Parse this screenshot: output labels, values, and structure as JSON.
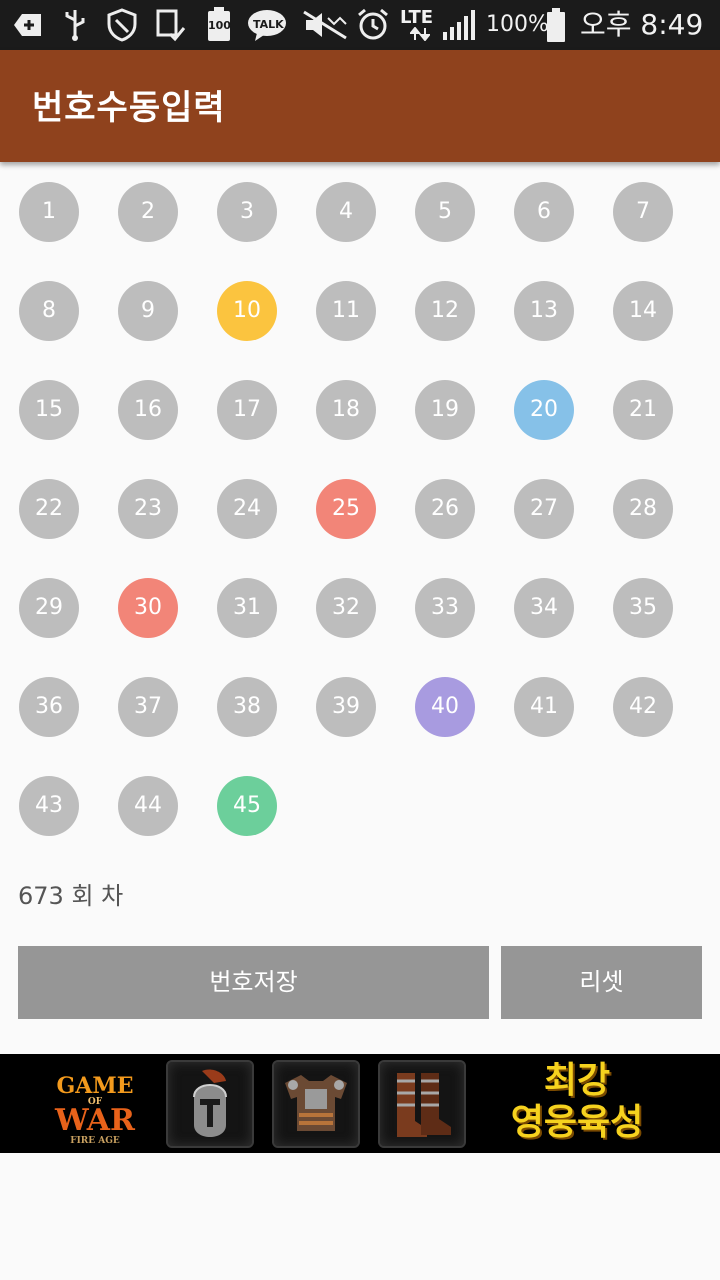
{
  "status_bar": {
    "battery_box": "100",
    "talk_label": "TALK",
    "network": "LTE",
    "battery_percent": "100%",
    "time": "오후 8:49"
  },
  "appbar": {
    "title": "번호수동입력"
  },
  "balls": [
    {
      "n": "1"
    },
    {
      "n": "2"
    },
    {
      "n": "3"
    },
    {
      "n": "4"
    },
    {
      "n": "5"
    },
    {
      "n": "6"
    },
    {
      "n": "7"
    },
    {
      "n": "8"
    },
    {
      "n": "9"
    },
    {
      "n": "10",
      "color": "yellow"
    },
    {
      "n": "11"
    },
    {
      "n": "12"
    },
    {
      "n": "13"
    },
    {
      "n": "14"
    },
    {
      "n": "15"
    },
    {
      "n": "16"
    },
    {
      "n": "17"
    },
    {
      "n": "18"
    },
    {
      "n": "19"
    },
    {
      "n": "20",
      "color": "blue"
    },
    {
      "n": "21"
    },
    {
      "n": "22"
    },
    {
      "n": "23"
    },
    {
      "n": "24"
    },
    {
      "n": "25",
      "color": "red"
    },
    {
      "n": "26"
    },
    {
      "n": "27"
    },
    {
      "n": "28"
    },
    {
      "n": "29"
    },
    {
      "n": "30",
      "color": "red"
    },
    {
      "n": "31"
    },
    {
      "n": "32"
    },
    {
      "n": "33"
    },
    {
      "n": "34"
    },
    {
      "n": "35"
    },
    {
      "n": "36"
    },
    {
      "n": "37"
    },
    {
      "n": "38"
    },
    {
      "n": "39"
    },
    {
      "n": "40",
      "color": "purple"
    },
    {
      "n": "41"
    },
    {
      "n": "42"
    },
    {
      "n": "43"
    },
    {
      "n": "44"
    },
    {
      "n": "45",
      "color": "green"
    }
  ],
  "ball_colors": {
    "default": "#bdbdbd",
    "yellow": "#fbc43f",
    "blue": "#86c1e8",
    "red": "#f28578",
    "purple": "#a89be0",
    "green": "#6ccf9b"
  },
  "round_label": "673 회 차",
  "buttons": {
    "save": "번호저장",
    "reset": "리셋"
  },
  "ad": {
    "logo_line1": "GAME",
    "logo_of": "OF",
    "logo_line2": "WAR",
    "logo_sub": "FIRE AGE",
    "items": [
      "helmet-icon",
      "armor-icon",
      "boots-icon"
    ],
    "copy_line1": "최강",
    "copy_line2": "영웅육성"
  },
  "colors": {
    "appbar": "#8f421d",
    "statusbar": "#1b1b1b",
    "button": "#969696"
  }
}
